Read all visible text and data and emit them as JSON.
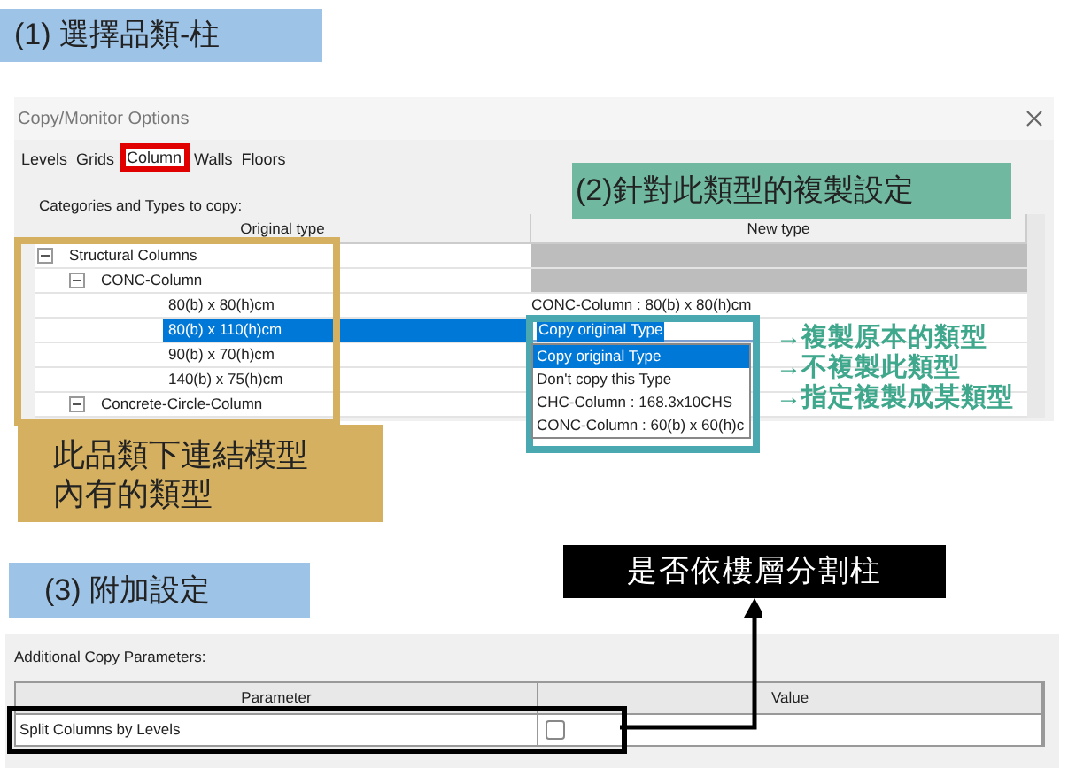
{
  "step1_label": "(1) 選擇品類-柱",
  "window": {
    "title": "Copy/Monitor Options"
  },
  "tabs": [
    {
      "label": "Levels",
      "selected": false
    },
    {
      "label": "Grids",
      "selected": false
    },
    {
      "label": "Column",
      "selected": true
    },
    {
      "label": "Walls",
      "selected": false
    },
    {
      "label": "Floors",
      "selected": false
    }
  ],
  "types": {
    "label": "Categories and Types to copy:",
    "columns": [
      "Original type",
      "New type"
    ],
    "tree": [
      {
        "label": "Structural Columns",
        "expanded": true,
        "selected": false,
        "children": [
          {
            "label": "CONC-Column",
            "expanded": true,
            "selected": false,
            "children": [
              {
                "label": "80(b) x 80(h)cm",
                "selected": false,
                "new_type": "CONC-Column : 80(b) x 80(h)cm"
              },
              {
                "label": "80(b) x 110(h)cm",
                "selected": true,
                "new_type": "Copy original Type"
              },
              {
                "label": "90(b) x 70(h)cm",
                "selected": false
              },
              {
                "label": "140(b) x 75(h)cm",
                "selected": false
              }
            ]
          },
          {
            "label": "Concrete-Circle-Column",
            "expanded": true,
            "selected": false
          }
        ]
      }
    ],
    "dropdown_options": [
      {
        "label": "Copy original Type",
        "selected": true
      },
      {
        "label": "Don't copy this Type",
        "selected": false
      },
      {
        "label": "CHC-Column : 168.3x10CHS",
        "selected": false
      },
      {
        "label": "CONC-Column : 60(b) x 60(h)c",
        "selected": false
      }
    ]
  },
  "annotations": {
    "step2": "(2)針對此類型的複製設定",
    "tree_note": "此品類下連結模型內有的類型",
    "option_notes": [
      "→複製原本的類型",
      "→不複製此類型",
      "→指定複製成某類型"
    ],
    "step3": "(3) 附加設定",
    "split_note": "是否依樓層分割柱"
  },
  "additional": {
    "label": "Additional Copy Parameters:",
    "columns": [
      "Parameter",
      "Value"
    ],
    "rows": [
      {
        "parameter": "Split Columns by Levels",
        "checked": false
      }
    ]
  }
}
